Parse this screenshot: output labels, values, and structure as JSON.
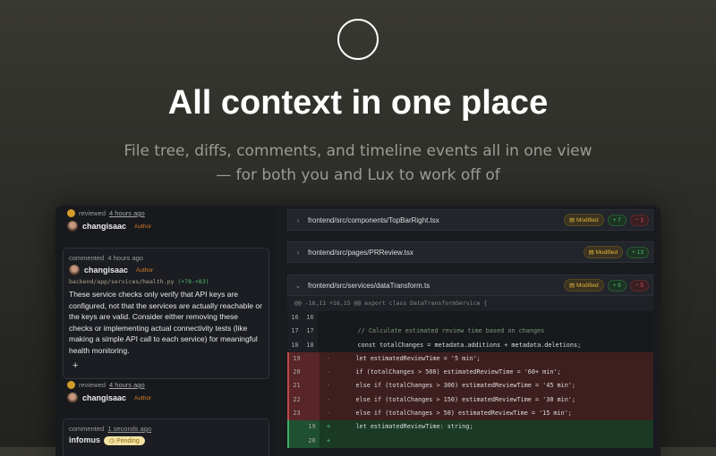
{
  "hero": {
    "title": "All context in one place",
    "subtitle_line1": "File tree, diffs, comments, and timeline events all in one view",
    "subtitle_line2": "— for both you and Lux to work off of"
  },
  "timeline": {
    "review1": {
      "action": "reviewed",
      "time": "4 hours ago",
      "user": "changisaac",
      "role": "Author"
    },
    "comment1": {
      "action": "commented",
      "time": "4 hours ago",
      "user": "changisaac",
      "role": "Author",
      "path": "backend/app/services/health.py",
      "range": "(+78-+83)",
      "body": "These service checks only verify that API keys are configured, not that the services are actually reachable or the keys are valid. Consider either removing these checks or implementing actual connectivity tests (like making a simple API call to each service) for meaningful health monitoring.",
      "add_label": "+"
    },
    "review2": {
      "action": "reviewed",
      "time": "4 hours ago",
      "user": "changisaac",
      "role": "Author"
    },
    "comment2": {
      "action": "commented",
      "time": "1 seconds ago",
      "user": "infomus",
      "status": "Pending"
    }
  },
  "files": [
    {
      "name": "frontend/src/components/TopBarRight.tsx",
      "status": "Modified",
      "additions": "+ 7",
      "deletions": "− 1",
      "expanded": false
    },
    {
      "name": "frontend/src/pages/PRReview.tsx",
      "status": "Modified",
      "additions": "+ 13",
      "expanded": false
    },
    {
      "name": "frontend/src/services/dataTransform.ts",
      "status": "Modified",
      "additions": "+ 9",
      "deletions": "− 5",
      "expanded": true
    }
  ],
  "diff": {
    "hunk": "@@ -16,11 +16,15 @@ export class DataTransformService {",
    "lines": [
      {
        "old": "16",
        "new": "16",
        "sign": "",
        "text": ""
      },
      {
        "old": "17",
        "new": "17",
        "sign": "",
        "text": "      // Calculate estimated review time based on changes"
      },
      {
        "old": "18",
        "new": "18",
        "sign": "",
        "text": "      const totalChanges = metadata.additions + metadata.deletions;"
      },
      {
        "old": "19",
        "new": "",
        "sign": "-",
        "text": "     let estimatedReviewTime = '5 min';"
      },
      {
        "old": "20",
        "new": "",
        "sign": "-",
        "text": "     if (totalChanges > 500) estimatedReviewTime = '60+ min';"
      },
      {
        "old": "21",
        "new": "",
        "sign": "-",
        "text": "     else if (totalChanges > 300) estimatedReviewTime = '45 min';"
      },
      {
        "old": "22",
        "new": "",
        "sign": "-",
        "text": "     else if (totalChanges > 150) estimatedReviewTime = '30 min';"
      },
      {
        "old": "23",
        "new": "",
        "sign": "-",
        "text": "     else if (totalChanges > 50) estimatedReviewTime = '15 min';"
      },
      {
        "old": "",
        "new": "19",
        "sign": "+",
        "text": "     let estimatedReviewTime: string;"
      },
      {
        "old": "",
        "new": "20",
        "sign": "+",
        "text": ""
      }
    ]
  }
}
